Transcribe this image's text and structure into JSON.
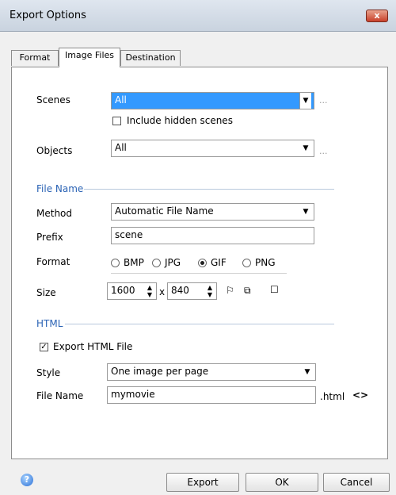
{
  "window": {
    "title": "Export Options",
    "close_glyph": "x"
  },
  "tabs": [
    {
      "label": "Format"
    },
    {
      "label": "Image Files"
    },
    {
      "label": "Destination"
    }
  ],
  "scenes": {
    "label": "Scenes",
    "value": "All",
    "ellipsis": "...",
    "include_hidden_label": "Include hidden scenes",
    "include_hidden_checked": false
  },
  "objects": {
    "label": "Objects",
    "value": "All",
    "ellipsis": "..."
  },
  "file_name_section": {
    "title": "File Name",
    "method_label": "Method",
    "method_value": "Automatic File Name",
    "prefix_label": "Prefix",
    "prefix_value": "scene",
    "format_label": "Format",
    "format_options": [
      "BMP",
      "JPG",
      "GIF",
      "PNG"
    ],
    "format_selected": "GIF",
    "size_label": "Size",
    "width": "1600",
    "x_sep": "x",
    "height": "840"
  },
  "html_section": {
    "title": "HTML",
    "export_label": "Export HTML File",
    "export_checked": true,
    "style_label": "Style",
    "style_value": "One image per page",
    "file_name_label": "File Name",
    "file_name_value": "mymovie",
    "extension": ".html",
    "code_glyph": "<>"
  },
  "buttons": {
    "export": "Export",
    "ok": "OK",
    "cancel": "Cancel",
    "help": "?"
  },
  "colors": {
    "selection": "#3399ff",
    "section_title": "#2b63b5"
  }
}
